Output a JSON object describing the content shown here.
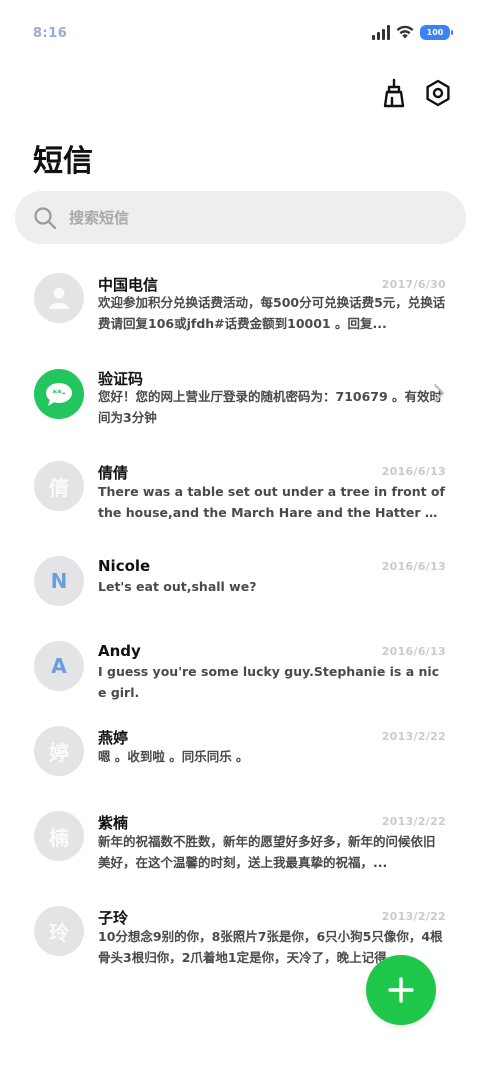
{
  "status_bar": {
    "time": "8:16",
    "battery": "100"
  },
  "header": {
    "title": "短信",
    "clean_icon": "broom-icon",
    "settings_icon": "hexagon-gear-icon"
  },
  "search": {
    "placeholder": "搜索短信"
  },
  "messages": [
    {
      "name": "中国电信",
      "avatar": "",
      "avatar_type": "person-icon",
      "date": "2017/6/30",
      "preview": "欢迎参加积分兑换话费活动，每500分可兑换话费5元，兑换话费请回复106或jfdh#话费金额到10001 。回复..."
    },
    {
      "name": "验证码",
      "avatar": "",
      "avatar_type": "chat-bubble-icon",
      "date": "",
      "preview": "您好！您的网上营业厅登录的随机密码为：710679 。有效时间为3分钟"
    },
    {
      "name": "倩倩",
      "avatar": "倩",
      "avatar_type": "text",
      "date": "2016/6/13",
      "preview": "There was a table set out under a tree in front of the house,and the March Hare and the Hatter were ..."
    },
    {
      "name": "Nicole",
      "avatar": "N",
      "avatar_type": "letter",
      "date": "2016/6/13",
      "preview": "Let's eat out,shall we?"
    },
    {
      "name": "Andy",
      "avatar": "A",
      "avatar_type": "letter",
      "date": "2016/6/13",
      "preview": "I guess you're some lucky guy.Stephanie is a nice girl."
    },
    {
      "name": "燕婷",
      "avatar": "婷",
      "avatar_type": "text",
      "date": "2013/2/22",
      "preview": "嗯 。收到啦 。同乐同乐 。"
    },
    {
      "name": "紫楠",
      "avatar": "楠",
      "avatar_type": "text",
      "date": "2013/2/22",
      "preview": "新年的祝福数不胜数，新年的愿望好多好多，新年的问候依旧美好，在这个温馨的时刻，送上我最真挚的祝福，..."
    },
    {
      "name": "子玲",
      "avatar": "玲",
      "avatar_type": "text",
      "date": "2013/2/22",
      "preview": "10分想念9别的你，8张照片7张是你，6只小狗5只像你，4根骨头3根归你，2爪着地1定是你，天冷了，晚上记得..."
    }
  ],
  "fab": {
    "icon": "plus-icon"
  }
}
